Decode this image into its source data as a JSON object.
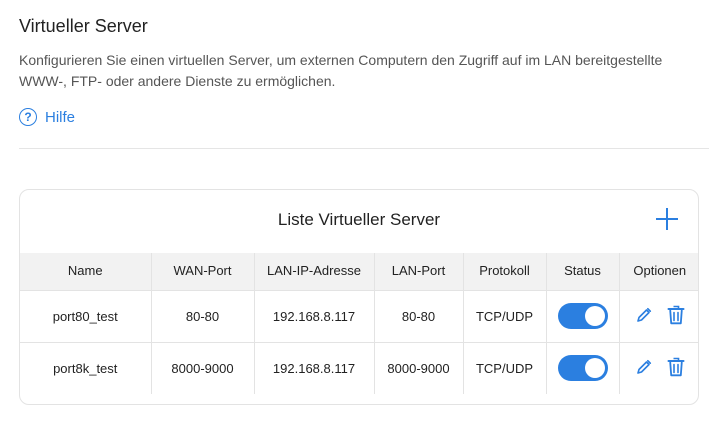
{
  "page": {
    "title": "Virtueller Server",
    "description": "Konfigurieren Sie einen virtuellen Server, um externen Computern den Zugriff auf im LAN bereitgestellte WWW-, FTP- oder andere Dienste zu ermöglichen.",
    "help": {
      "icon_glyph": "?",
      "label": "Hilfe",
      "icon": "question-circle-icon"
    }
  },
  "list": {
    "title": "Liste Virtueller Server",
    "add_icon": "plus-icon",
    "columns": {
      "name": "Name",
      "wan_port": "WAN-Port",
      "lan_ip": "LAN-IP-Adresse",
      "lan_port": "LAN-Port",
      "protocol": "Protokoll",
      "status": "Status",
      "options": "Optionen"
    },
    "rows": [
      {
        "name": "port80_test",
        "wan_port": "80-80",
        "lan_ip": "192.168.8.117",
        "lan_port": "80-80",
        "protocol": "TCP/UDP",
        "status": "on"
      },
      {
        "name": "port8k_test",
        "wan_port": "8000-9000",
        "lan_ip": "192.168.8.117",
        "lan_port": "8000-9000",
        "protocol": "TCP/UDP",
        "status": "on"
      }
    ]
  },
  "colors": {
    "accent": "#2b7fe0",
    "header_bg": "#f2f2f2",
    "border": "#e3e3e3"
  }
}
